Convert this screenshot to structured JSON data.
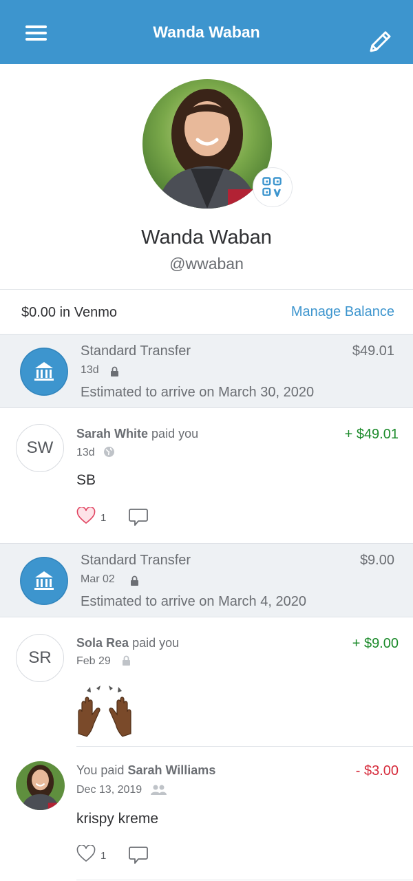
{
  "header": {
    "title": "Wanda Waban"
  },
  "profile": {
    "name": "Wanda Waban",
    "handle": "@wwaban"
  },
  "balance": {
    "text": "$0.00 in Venmo",
    "manage_label": "Manage Balance"
  },
  "colors": {
    "brand": "#3D95CE",
    "positive": "#1b8a2a",
    "negative": "#d62a3a"
  },
  "feed": {
    "transfer1": {
      "title": "Standard Transfer",
      "amount": "$49.01",
      "date": "13d",
      "subtitle": "Estimated to arrive on March 30, 2020"
    },
    "item1": {
      "initials": "SW",
      "name": "Sarah White",
      "action": "paid you",
      "amount": "+ $49.01",
      "date": "13d",
      "privacy_icon": "globe-icon",
      "note": "SB",
      "like_count": "1"
    },
    "transfer2": {
      "title": "Standard Transfer",
      "amount": "$9.00",
      "date": "Mar 02",
      "subtitle": "Estimated to arrive on March 4, 2020"
    },
    "item2": {
      "initials": "SR",
      "name": "Sola Rea",
      "action": "paid you",
      "amount": "+ $9.00",
      "date": "Feb 29",
      "privacy_icon": "lock-icon",
      "note_icon": "raised-hands-emoji"
    },
    "item3": {
      "prefix": "You paid",
      "name": "Sarah Williams",
      "amount": "- $3.00",
      "date": "Dec 13, 2019",
      "privacy_icon": "friends-icon",
      "note": "krispy kreme",
      "like_count": "1"
    }
  }
}
